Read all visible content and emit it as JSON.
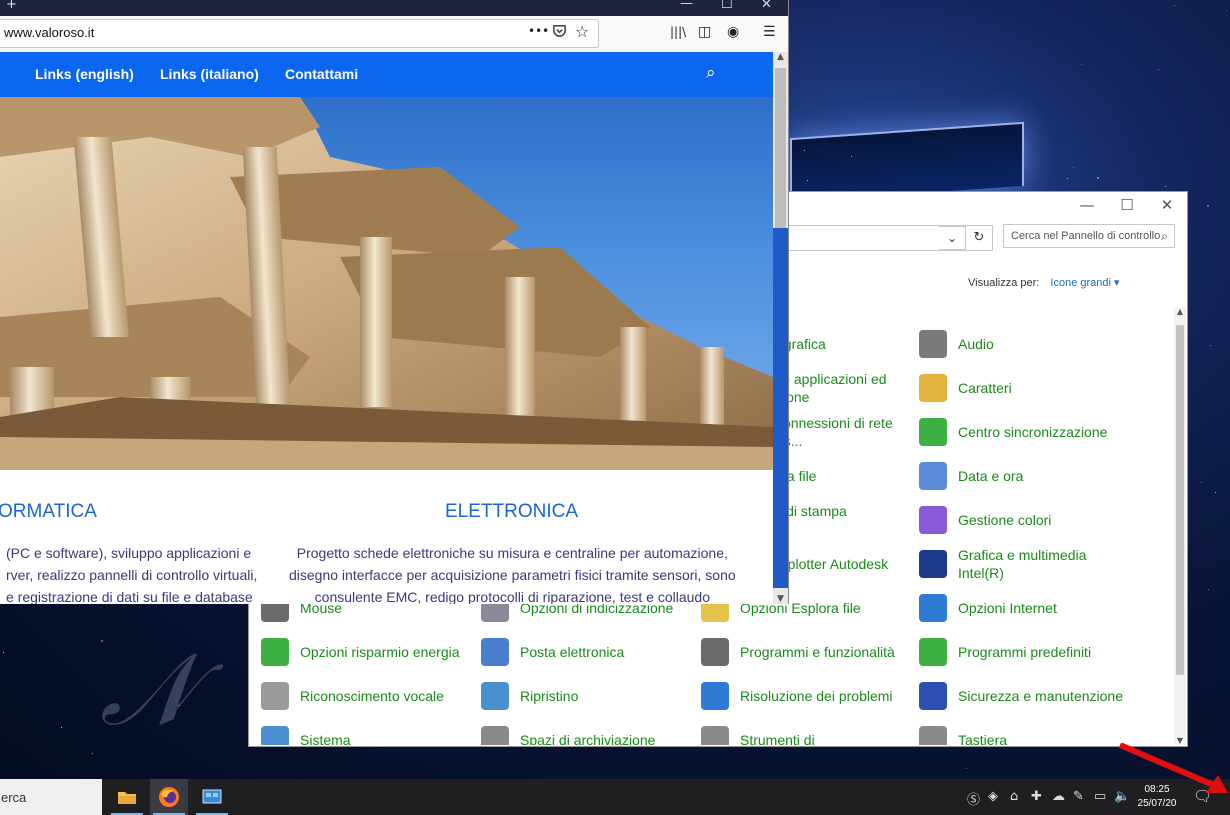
{
  "firefox": {
    "url": "www.valoroso.it",
    "titlebar": {
      "new_tab": "+",
      "minimize": "—",
      "maximize": "☐",
      "close": "✕"
    },
    "toolbar": {
      "more": "•••",
      "library": "|||\\",
      "sidebar": "◫",
      "account": "◉",
      "menu": "☰"
    }
  },
  "site": {
    "menu": [
      {
        "label": "Links (english)"
      },
      {
        "label": "Links (italiano)"
      },
      {
        "label": "Contattami"
      }
    ],
    "section_left": {
      "title": "ORMATICA",
      "lines": [
        "(PC e software), sviluppo applicazioni e",
        "rver, realizzo pannelli di controllo virtuali,",
        "e registrazione di dati su file e database"
      ]
    },
    "section_right": {
      "title": "ELETTRONICA",
      "lines": [
        "Progetto schede elettroniche su misura e centraline per automazione,",
        "disegno interfacce per acquisizione parametri fisici tramite sensori, sono",
        "consulente EMC, redigo protocolli di riparazione, test e collaudo"
      ]
    }
  },
  "control_panel": {
    "search_placeholder": "Cerca nel Pannello di controllo",
    "view_by_label": "Visualizza per:",
    "view_by_value": "Icone grandi",
    "items": [
      {
        "label": "ografica",
        "icon": "partial-icon",
        "color": "#2f7bd4"
      },
      {
        "label": "Audio",
        "icon": "speaker-icon",
        "color": "#7a7a7a"
      },
      {
        "label": "lle applicazioni ed",
        "label2": "zione",
        "icon": "partial-icon",
        "color": "#2f7bd4"
      },
      {
        "label": "Caratteri",
        "icon": "fonts-icon",
        "color": "#e3b23c"
      },
      {
        "label": "connessioni di rete",
        "label2": "ris...",
        "icon": "partial-icon",
        "color": "#2f7bd4"
      },
      {
        "label": "Centro sincronizzazione",
        "icon": "sync-icon",
        "color": "#3cb043"
      },
      {
        "label": "gia file",
        "icon": "partial-icon",
        "color": "#2f7bd4"
      },
      {
        "label": "Data e ora",
        "icon": "clock-icon",
        "color": "#5a8ad8"
      },
      {
        "label": "li di stampa",
        "label2": "k",
        "icon": "partial-icon",
        "color": "#2f7bd4"
      },
      {
        "label": "Gestione colori",
        "icon": "color-icon",
        "color": "#8a5ad8"
      },
      {
        "label": "e plotter Autodesk",
        "icon": "partial-icon",
        "color": "#2f7bd4"
      },
      {
        "label": "Grafica e multimedia",
        "label2": "Intel(R)",
        "icon": "intel-graphics-icon",
        "color": "#1e3a8a"
      },
      {
        "label": "Mouse",
        "icon": "mouse-icon",
        "color": "#6b6b6b"
      },
      {
        "label": "Opzioni di indicizzazione",
        "icon": "indexing-icon",
        "color": "#8a8a9a"
      },
      {
        "label": "Opzioni Esplora file",
        "icon": "folder-options-icon",
        "color": "#e6c24a"
      },
      {
        "label": "Opzioni Internet",
        "icon": "internet-icon",
        "color": "#2f7bd4"
      },
      {
        "label": "Opzioni risparmio energia",
        "icon": "power-icon",
        "color": "#3cb043"
      },
      {
        "label": "Posta elettronica",
        "icon": "mail-icon",
        "color": "#4a7fd0"
      },
      {
        "label": "Programmi e funzionalità",
        "icon": "programs-icon",
        "color": "#6b6b6b"
      },
      {
        "label": "Programmi predefiniti",
        "icon": "default-programs-icon",
        "color": "#3cb043"
      },
      {
        "label": "Riconoscimento vocale",
        "icon": "microphone-icon",
        "color": "#9a9a9a"
      },
      {
        "label": "Ripristino",
        "icon": "recovery-icon",
        "color": "#4a90d0"
      },
      {
        "label": "Risoluzione dei problemi",
        "icon": "troubleshoot-icon",
        "color": "#2f7bd4"
      },
      {
        "label": "Sicurezza e manutenzione",
        "icon": "flag-icon",
        "color": "#2f4fb0"
      },
      {
        "label": "Sistema",
        "icon": "system-icon",
        "color": "#4a90d0"
      },
      {
        "label": "Spazi di archiviazione",
        "icon": "storage-icon",
        "color": "#8a8a8a"
      },
      {
        "label": "Strumenti di",
        "icon": "tools-icon",
        "color": "#8a8a8a"
      },
      {
        "label": "Tastiera",
        "icon": "keyboard-icon",
        "color": "#8a8a8a"
      }
    ]
  },
  "taskbar": {
    "search_text": "erca",
    "time": "08:25",
    "date": "25/07/20"
  }
}
